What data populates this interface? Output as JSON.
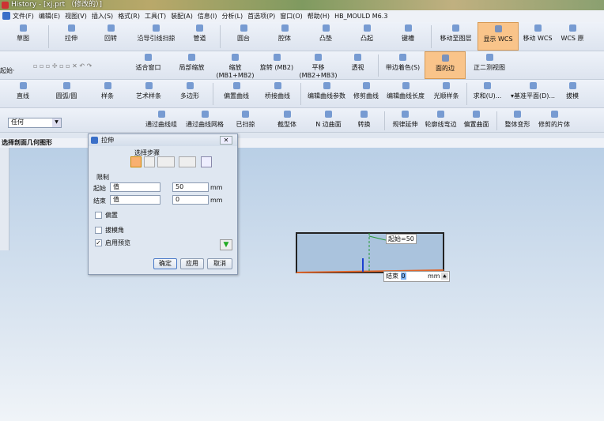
{
  "title": "History - [xj.prt （修改的）]",
  "menu": [
    "文件(F)",
    "编辑(E)",
    "视图(V)",
    "插入(S)",
    "格式(R)",
    "工具(T)",
    "装配(A)",
    "信息(I)",
    "分析(L)",
    "首选项(P)",
    "窗口(O)",
    "帮助(H)",
    "HB_MOULD M6.3"
  ],
  "row1": [
    "草图",
    "拉伸",
    "回转",
    "沿导引线扫掠",
    "管道",
    "圆台",
    "腔体",
    "凸垫",
    "凸起",
    "键槽",
    "移动至图层",
    "显示 WCS",
    "移动 WCS",
    "WCS 原"
  ],
  "row2": {
    "start": "起始·",
    "items": [
      "适合窗口",
      "局部缩放",
      "缩放 (MB1+MB2)",
      "旋转 (MB2)",
      "平移 (MB2+MB3)",
      "透视",
      "带边着色(S)",
      "面的边",
      "正二测视图"
    ]
  },
  "row3": [
    "直线",
    "圆弧/圆",
    "样条",
    "艺术样条",
    "多边形",
    "偏置曲线",
    "桥接曲线",
    "编辑曲线参数",
    "修剪曲线",
    "编辑曲线长度",
    "光顺样条",
    "求和(U)...",
    "▾基准平面(D)...",
    "拔模"
  ],
  "row4": {
    "filter": "任何",
    "items": [
      "通过曲线组",
      "通过曲线网格",
      "已扫掠",
      "截型体",
      "N 边曲面",
      "转换",
      "规律延伸",
      "轮廓线弯边",
      "偏置曲面",
      "整体变形",
      "修剪的片体"
    ]
  },
  "status": "选择剖面几何图形",
  "dialog": {
    "title": "拉伸",
    "steps": "选择步骤",
    "limits": "限制",
    "start_label": "起始",
    "end_label": "结束",
    "start_type": "值",
    "end_type": "值",
    "start_value": "50",
    "end_value": "0",
    "unit": "mm",
    "offset": "偏置",
    "draft": "拔模角",
    "preview": "启用预览",
    "preview_checked": true,
    "ok": "确定",
    "apply": "应用",
    "cancel": "取消"
  },
  "viewport": {
    "start_tag": "起始=50",
    "end_label": "结束",
    "end_value": "0",
    "unit": "mm"
  }
}
